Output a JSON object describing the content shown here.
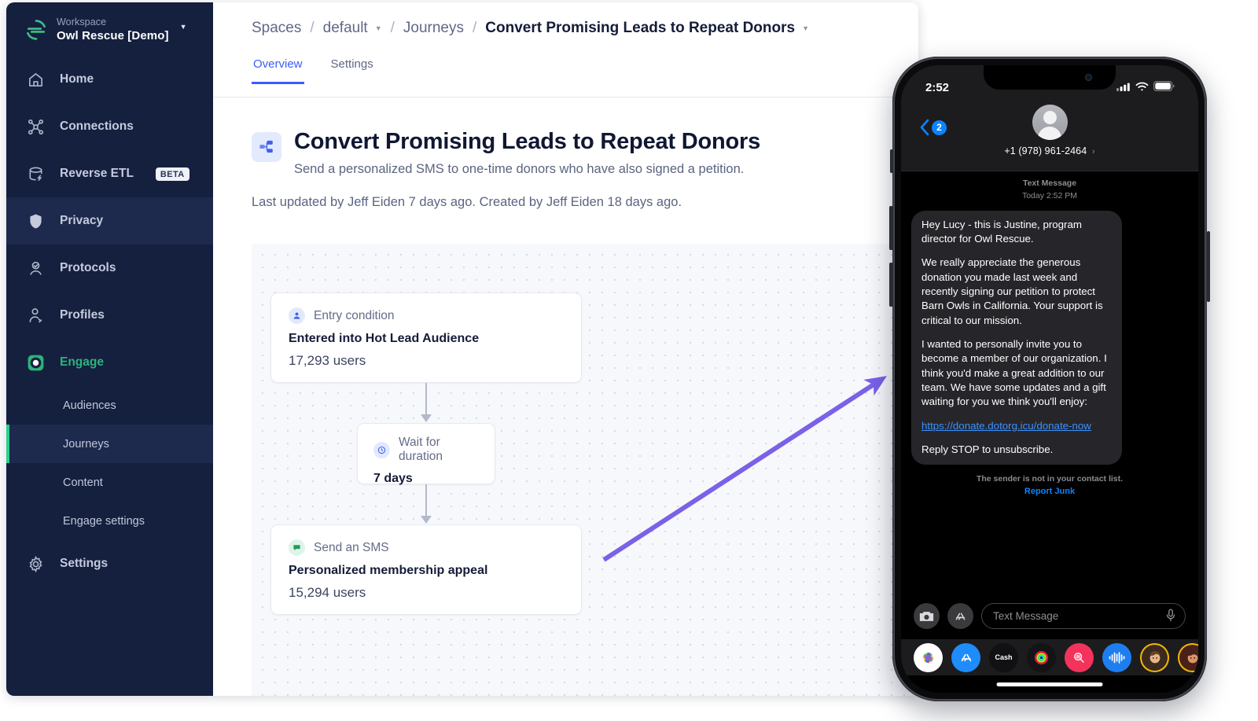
{
  "sidebar": {
    "workspace_label": "Workspace",
    "workspace_name": "Owl Rescue [Demo]",
    "items": [
      {
        "label": "Home",
        "icon": "home-icon"
      },
      {
        "label": "Connections",
        "icon": "connections-icon"
      },
      {
        "label": "Reverse ETL",
        "icon": "database-icon",
        "badge": "BETA"
      },
      {
        "label": "Privacy",
        "icon": "shield-icon"
      },
      {
        "label": "Protocols",
        "icon": "protocols-icon"
      },
      {
        "label": "Profiles",
        "icon": "profile-icon"
      },
      {
        "label": "Engage",
        "icon": "engage-icon"
      }
    ],
    "sub_items": [
      {
        "label": "Audiences"
      },
      {
        "label": "Journeys"
      },
      {
        "label": "Content"
      },
      {
        "label": "Engage settings"
      }
    ],
    "settings_label": "Settings",
    "accent_green": "#2bcf8c"
  },
  "breadcrumb": {
    "spaces": "Spaces",
    "space_name": "default",
    "section": "Journeys",
    "current": "Convert Promising Leads to Repeat Donors",
    "separator": "/"
  },
  "tabs": [
    {
      "label": "Overview",
      "active": true
    },
    {
      "label": "Settings",
      "active": false
    }
  ],
  "hero": {
    "title": "Convert Promising Leads to Repeat Donors",
    "subtitle": "Send a personalized SMS to one-time donors who have also signed a petition.",
    "meta": "Last updated by Jeff Eiden 7 days ago. Created by Jeff Eiden 18 days ago."
  },
  "journey": {
    "nodes": [
      {
        "kind": "Entry condition",
        "title": "Entered into Hot Lead Audience",
        "count": "17,293 users",
        "icon": "entry-condition-icon"
      },
      {
        "kind": "Wait for duration",
        "title": "7 days",
        "count": "",
        "icon": "clock-icon"
      },
      {
        "kind": "Send an SMS",
        "title": "Personalized membership appeal",
        "count": "15,294 users",
        "icon": "sms-icon"
      }
    ],
    "arrow_color": "#7b61e8"
  },
  "phone": {
    "status": {
      "time": "2:52",
      "signal": "signal-icon",
      "wifi": "wifi-icon",
      "battery": "battery-icon"
    },
    "header": {
      "unread_count": "2",
      "contact": "+1 (978) 961-2464"
    },
    "thread_meta_line1": "Text Message",
    "thread_meta_line2": "Today 2:52 PM",
    "message": {
      "p1": "Hey Lucy - this is Justine, program director for Owl Rescue.",
      "p2": "We really appreciate the generous donation you made last week and recently signing our petition to protect Barn Owls in California. Your support is critical to our mission.",
      "p3": "I wanted to personally invite you to become a member of our organization. I think you'd make a great addition to our team. We have some updates and a gift waiting for you we think you'll enjoy:",
      "link": "https://donate.dotorg.icu/donate-now",
      "p4": "Reply STOP to unsubscribe."
    },
    "notice_line1": "The sender is not in your contact list.",
    "notice_line2": "Report Junk",
    "composer": {
      "placeholder": "Text Message",
      "camera": "camera-icon",
      "apps": "app-store-icon",
      "mic": "microphone-icon"
    },
    "dock_apps": [
      {
        "name": "photos-app-icon",
        "label": ""
      },
      {
        "name": "app-store-app-icon",
        "label": ""
      },
      {
        "name": "apple-cash-app-icon",
        "label": "Cash"
      },
      {
        "name": "fitness-app-icon",
        "label": ""
      },
      {
        "name": "search-images-app-icon",
        "label": ""
      },
      {
        "name": "voice-memo-app-icon",
        "label": ""
      },
      {
        "name": "memoji-app-icon",
        "label": ""
      },
      {
        "name": "memoji-2-app-icon",
        "label": ""
      }
    ]
  }
}
